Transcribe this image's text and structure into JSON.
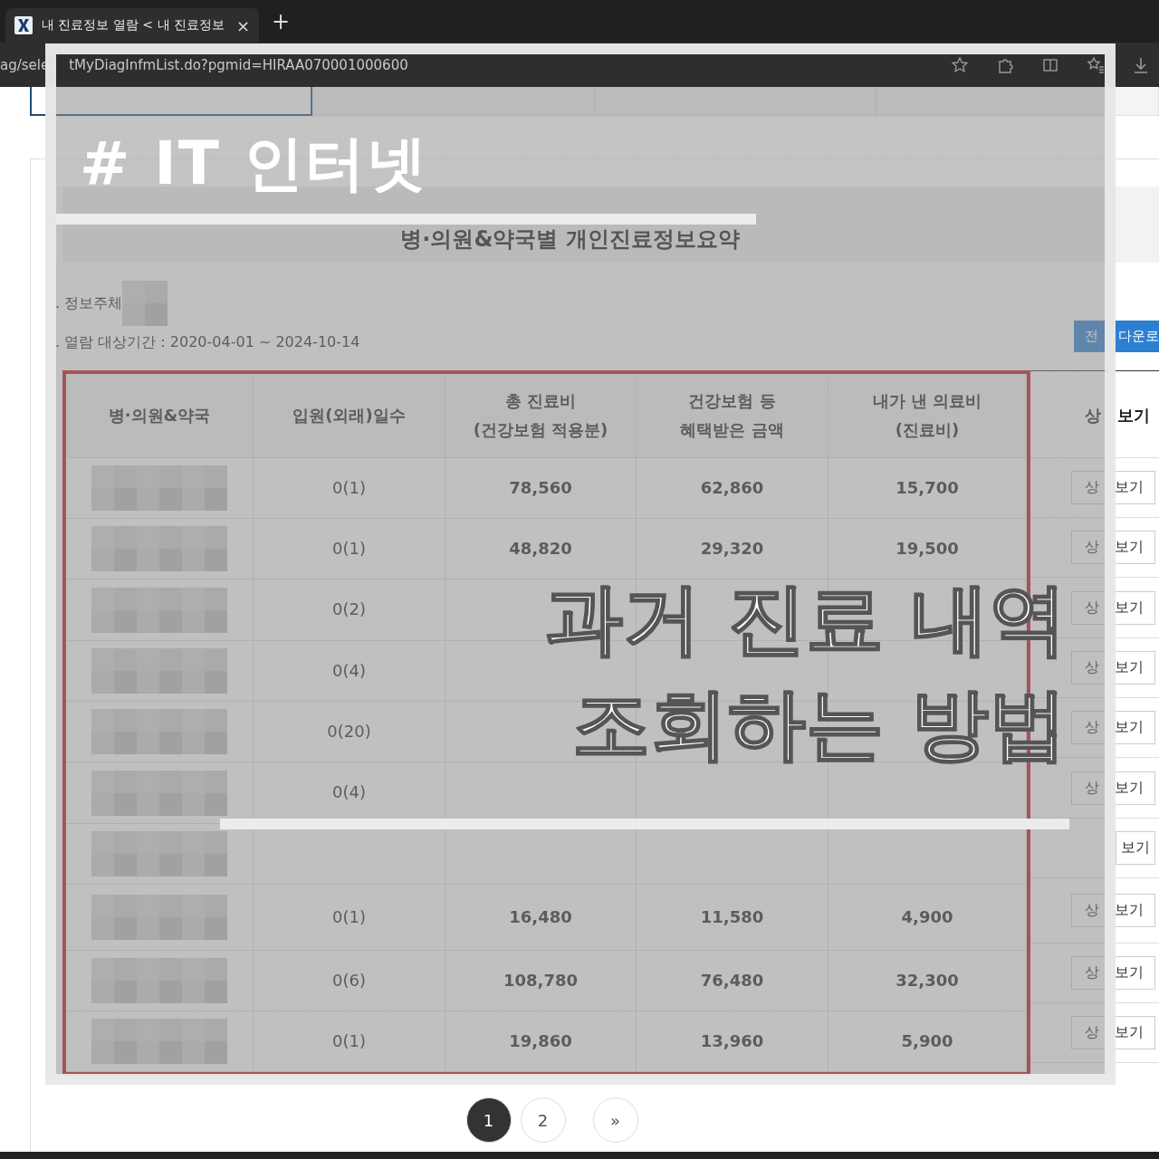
{
  "browser": {
    "tab_title": "내 진료정보 열람 < 내 진료정보",
    "tab_close": "×",
    "new_tab": "+",
    "url_parts": [
      "ag/sele",
      "tMyDiagInfmList.do?pgmid=HIRAA070001000600"
    ]
  },
  "page_tabs": [
    {
      "selected": true
    },
    {
      "selected": false
    },
    {
      "selected": false
    },
    {
      "selected": false
    }
  ],
  "summary": {
    "title": "병·의원&약국별 개인진료정보요약",
    "subject_label": ". 정보주체",
    "period": ". 열람 대상기간 : 2020-04-01 ~ 2024-10-14",
    "download_button_parts": [
      "전",
      "다운로"
    ]
  },
  "table": {
    "columns": [
      "병·의원&약국",
      "입원(외래)일수",
      "총 진료비\n(건강보험 적용분)",
      "건강보험 등\n혜택받은 금액",
      "내가 낸 의료비\n(진료비)"
    ],
    "detail_header_parts": [
      "상",
      "보기"
    ],
    "rows": [
      {
        "days": "0(1)",
        "total": "78,560",
        "benefit": "62,860",
        "paid": "15,700",
        "detail_parts": [
          "상",
          "보기"
        ]
      },
      {
        "days": "0(1)",
        "total": "48,820",
        "benefit": "29,320",
        "paid": "19,500",
        "detail_parts": [
          "상",
          "보기"
        ]
      },
      {
        "days": "0(2)",
        "detail_parts": [
          "상",
          "보기"
        ]
      },
      {
        "days": "0(4)",
        "detail_parts": [
          "상",
          "보기"
        ]
      },
      {
        "days": "0(20)",
        "detail_parts": [
          "상",
          "보기"
        ]
      },
      {
        "days": "0(4)",
        "detail_parts": [
          "상",
          "보기"
        ]
      },
      {
        "detail_parts": [
          "보기"
        ]
      },
      {
        "days": "0(1)",
        "total": "16,480",
        "benefit": "11,580",
        "paid": "4,900",
        "detail_parts": [
          "상",
          "보기"
        ]
      },
      {
        "days": "0(6)",
        "total": "108,780",
        "benefit": "76,480",
        "paid": "32,300",
        "detail_parts": [
          "상",
          "보기"
        ]
      },
      {
        "days": "0(1)",
        "total": "19,860",
        "benefit": "13,960",
        "paid": "5,900",
        "detail_parts": [
          "상",
          "보기"
        ]
      }
    ]
  },
  "pagination": [
    {
      "label": "1",
      "selected": true
    },
    {
      "label": "2",
      "selected": false
    },
    {
      "label": "»",
      "selected": false
    }
  ],
  "overlay": {
    "tag": "# IT 인터넷",
    "headline": [
      "과거 진료 내역",
      "조회하는 방법"
    ]
  }
}
